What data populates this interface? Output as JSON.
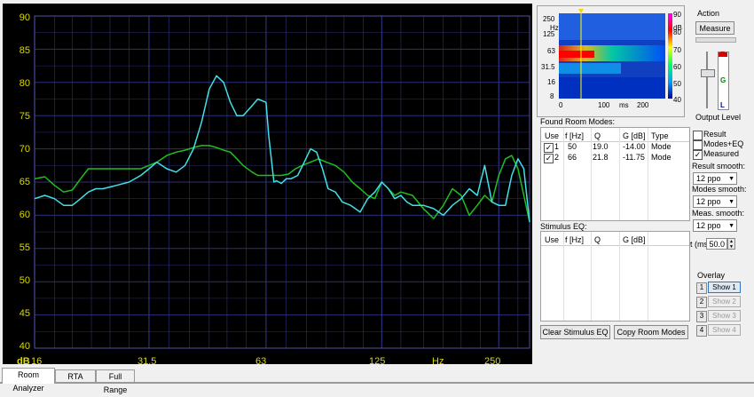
{
  "plot": {
    "y_ticks": [
      "90",
      "85",
      "80",
      "75",
      "70",
      "65",
      "60",
      "55",
      "50",
      "45",
      "40"
    ],
    "y_unit": "dB",
    "x_ticks": [
      "16",
      "31.5",
      "63",
      "125",
      "250"
    ],
    "x_unit": "Hz",
    "bg_color": "#000000",
    "grid_color": "#2f2f7a",
    "green_color": "#1fbf1f",
    "cyan_color": "#40e0e8"
  },
  "chart_data": {
    "type": "line",
    "x_scale": "log",
    "xlim": [
      16,
      300
    ],
    "ylim": [
      40,
      90
    ],
    "series": [
      {
        "color": "#1fbf1f",
        "x": [
          16,
          17,
          18,
          19,
          20,
          21,
          22,
          23,
          24,
          26,
          28,
          30,
          31.5,
          33,
          35,
          37,
          39,
          41,
          43,
          45,
          47,
          49,
          51,
          53,
          55,
          58,
          60,
          63,
          66,
          69,
          72,
          75,
          78,
          82,
          86,
          90,
          95,
          100,
          105,
          110,
          115,
          120,
          125,
          130,
          135,
          140,
          150,
          160,
          170,
          180,
          190,
          200,
          210,
          220,
          230,
          240,
          250,
          260,
          270,
          280,
          290,
          300
        ],
        "y": [
          65.5,
          65.8,
          64.5,
          63.5,
          63.8,
          65.5,
          67,
          67,
          67,
          67,
          67,
          67,
          67.5,
          68,
          69,
          69.5,
          69.8,
          70.2,
          70.5,
          70.5,
          70.2,
          69.8,
          69.5,
          68.5,
          67.5,
          66.5,
          66,
          66,
          66,
          66,
          66.2,
          67,
          67.5,
          68,
          68.5,
          68,
          67.5,
          66.5,
          65,
          64,
          63,
          62.5,
          65,
          64,
          63,
          63.5,
          63,
          61,
          59.5,
          61.5,
          64,
          63,
          60,
          61.5,
          63,
          62,
          66,
          68.5,
          69,
          67,
          63,
          59
        ]
      },
      {
        "color": "#40e0e8",
        "x": [
          16,
          17,
          18,
          19,
          20,
          21,
          22,
          23,
          24,
          26,
          28,
          30,
          31.5,
          33,
          35,
          37,
          39,
          41,
          43,
          45,
          47,
          49,
          51,
          53,
          55,
          58,
          60,
          63,
          64,
          66,
          67,
          69,
          71,
          73,
          76,
          79,
          82,
          85,
          88,
          91,
          95,
          99,
          104,
          110,
          115,
          120,
          125,
          130,
          135,
          140,
          145,
          150,
          160,
          170,
          180,
          190,
          200,
          210,
          220,
          230,
          240,
          250,
          260,
          270,
          280,
          290,
          300
        ],
        "y": [
          62.5,
          63,
          62.5,
          61.5,
          61.5,
          62.5,
          63.5,
          64,
          64,
          64.5,
          65,
          66,
          67,
          68,
          67,
          66.5,
          67.5,
          70,
          74,
          79,
          81,
          80,
          77,
          75,
          75,
          76.5,
          77.5,
          77,
          72,
          65,
          65.2,
          64.8,
          65.5,
          65.5,
          66,
          68,
          70,
          69.5,
          67,
          64,
          63.5,
          62,
          61.5,
          60.5,
          62.5,
          63.5,
          65,
          64,
          62.5,
          63,
          62,
          61.5,
          61.5,
          61,
          60,
          61.5,
          62.5,
          64,
          63,
          67.5,
          62,
          61.5,
          61.5,
          66,
          68.5,
          67,
          59
        ]
      }
    ]
  },
  "spectrogram": {
    "y_labels": [
      "250",
      "125",
      "63",
      "31.5",
      "16",
      "8"
    ],
    "y_unit": "Hz",
    "x_labels": [
      "0",
      "100",
      "200"
    ],
    "x_unit": "ms",
    "scale_unit": "dB",
    "scale_labels": [
      "90",
      "80",
      "70",
      "60",
      "50",
      "40"
    ]
  },
  "action": {
    "title": "Action",
    "measure_label": "Measure",
    "meter_top": "R",
    "meter_mid": "G",
    "meter_bot": "L",
    "output_level_label": "Output Level"
  },
  "room_modes": {
    "title": "Found Room Modes:",
    "headers": [
      "Use",
      "f [Hz]",
      "Q",
      "G [dB]",
      "Type"
    ],
    "rows": [
      {
        "use": "1",
        "f": "50",
        "q": "19.0",
        "g": "-14.00",
        "type": "Mode"
      },
      {
        "use": "2",
        "f": "66",
        "q": "21.8",
        "g": "-11.75",
        "type": "Mode"
      }
    ]
  },
  "stimulus_eq": {
    "title": "Stimulus EQ:",
    "headers": [
      "Use",
      "f [Hz]",
      "Q",
      "G [dB]"
    ]
  },
  "checkboxes": [
    {
      "label": "Result",
      "checked": false
    },
    {
      "label": "Modes+EQ",
      "checked": false
    },
    {
      "label": "Measured",
      "checked": true
    }
  ],
  "smoothing": {
    "result_label": "Result smooth:",
    "result_value": "12 ppo",
    "modes_label": "Modes smooth:",
    "modes_value": "12 ppo",
    "meas_label": "Meas. smooth:",
    "meas_value": "12 ppo"
  },
  "t_ms": {
    "label": "t (ms)",
    "value": "50.0"
  },
  "overlay": {
    "title": "Overlay",
    "items": [
      {
        "num": "1",
        "label": "Show 1"
      },
      {
        "num": "2",
        "label": "Show 2"
      },
      {
        "num": "3",
        "label": "Show 3"
      },
      {
        "num": "4",
        "label": "Show 4"
      }
    ]
  },
  "buttons": {
    "clear_stimulus": "Clear Stimulus EQ",
    "copy_room_modes": "Copy Room Modes"
  },
  "tabs": [
    "Room Analyzer",
    "RTA",
    "Full Range"
  ]
}
